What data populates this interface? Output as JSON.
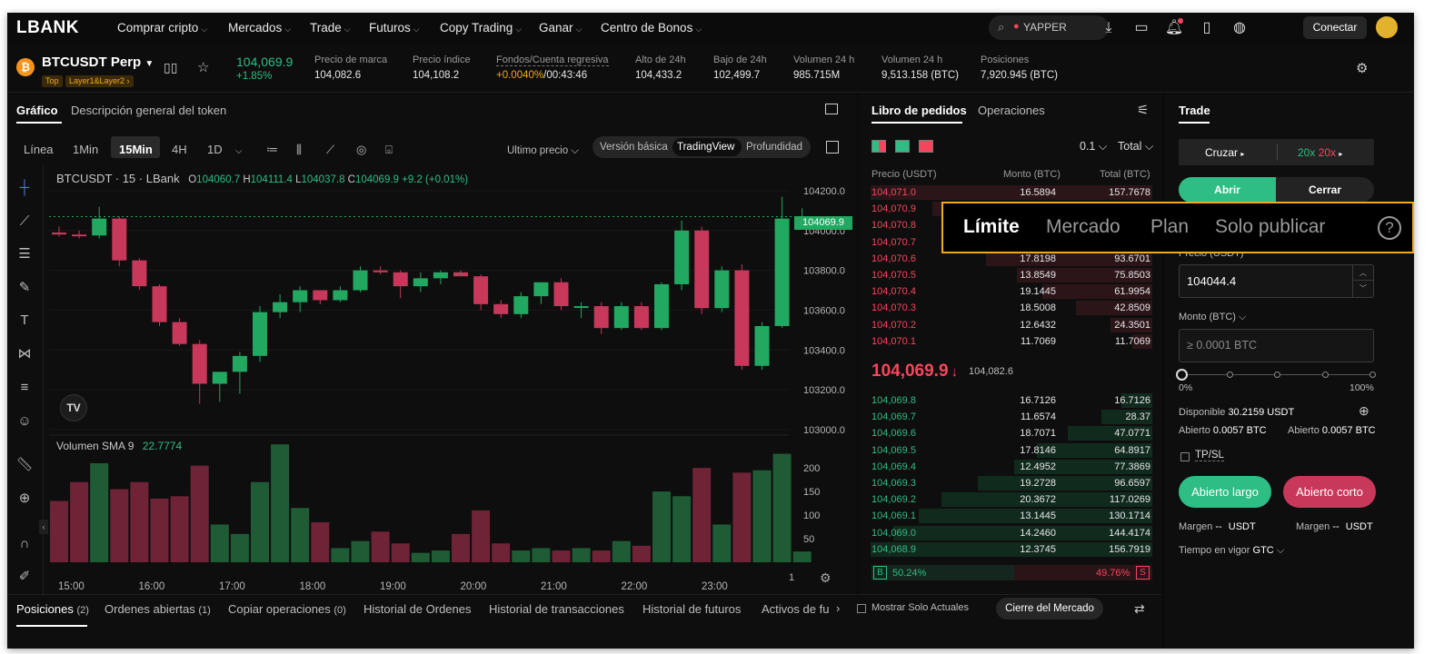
{
  "nav": {
    "logo": "LBANK",
    "items": [
      "Comprar cripto",
      "Mercados",
      "Trade",
      "Futuros",
      "Copy Trading",
      "Ganar",
      "Centro de Bonos"
    ],
    "search_placeholder": "YAPPER",
    "connect": "Conectar"
  },
  "ticker": {
    "pair": "BTCUSDT Perp",
    "tag_top": "Top",
    "tag_layer": "Layer1&Layer2",
    "price": "104,069.9",
    "change": "+1.85%",
    "stats": [
      {
        "label": "Precio de marca",
        "value": "104,082.6"
      },
      {
        "label": "Precio índice",
        "value": "104,108.2"
      },
      {
        "label": "Fondos/Cuenta regresiva",
        "value_rate": "+0.0040%",
        "value_timer": "/00:43:46"
      },
      {
        "label": "Alto de 24h",
        "value": "104,433.2"
      },
      {
        "label": "Bajo de 24h",
        "value": "102,499.7"
      },
      {
        "label": "Volumen 24 h",
        "value": "985.715M"
      },
      {
        "label": "Volumen 24 h",
        "value": "9,513.158 (BTC)"
      },
      {
        "label": "Posiciones",
        "value": "7,920.945 (BTC)"
      }
    ]
  },
  "chart_panel": {
    "tabs": [
      "Gráfico",
      "Descripción general del token"
    ],
    "timeframes": [
      "Línea",
      "1Min",
      "15Min",
      "4H",
      "1D"
    ],
    "active_timeframe": "15Min",
    "price_mode": "Ultimo precio",
    "views": [
      "Versión básica",
      "TradingView",
      "Profundidad"
    ],
    "active_view": "TradingView",
    "symbol_line": "BTCUSDT · 15 · LBank",
    "ohlc": {
      "o": "104060.7",
      "h": "104111.4",
      "l": "104037.8",
      "c": "104069.9",
      "chg": "+9.2 (+0.01%)"
    },
    "last_price_label": "104069.9",
    "volume_label": "Volumen SMA 9",
    "volume_value": "22.7774",
    "scale_mode": "1"
  },
  "chart_data": {
    "type": "candlestick",
    "x_ticks": [
      "15:00",
      "16:00",
      "17:00",
      "18:00",
      "19:00",
      "20:00",
      "21:00",
      "22:00",
      "23:00"
    ],
    "y_ticks": [
      104200.0,
      104000.0,
      103800.0,
      103600.0,
      103400.0,
      103200.0,
      103000.0
    ],
    "ylim": [
      102995,
      104250
    ],
    "volume_ticks": [
      200,
      150,
      100,
      50
    ],
    "volume_ylim": [
      0,
      260
    ],
    "candles": [
      {
        "o": 103990,
        "h": 104020,
        "l": 103970,
        "c": 103980,
        "v": 130
      },
      {
        "o": 103980,
        "h": 104000,
        "l": 103960,
        "c": 103975,
        "v": 170
      },
      {
        "o": 103975,
        "h": 104120,
        "l": 103960,
        "c": 104060,
        "v": 210
      },
      {
        "o": 104060,
        "h": 104070,
        "l": 103820,
        "c": 103850,
        "v": 155
      },
      {
        "o": 103850,
        "h": 103860,
        "l": 103700,
        "c": 103720,
        "v": 170
      },
      {
        "o": 103720,
        "h": 103730,
        "l": 103520,
        "c": 103540,
        "v": 135
      },
      {
        "o": 103540,
        "h": 103560,
        "l": 103420,
        "c": 103430,
        "v": 140
      },
      {
        "o": 103430,
        "h": 103450,
        "l": 103130,
        "c": 103230,
        "v": 205
      },
      {
        "o": 103230,
        "h": 103290,
        "l": 103140,
        "c": 103290,
        "v": 80
      },
      {
        "o": 103290,
        "h": 103390,
        "l": 103180,
        "c": 103370,
        "v": 60
      },
      {
        "o": 103370,
        "h": 103620,
        "l": 103340,
        "c": 103590,
        "v": 170
      },
      {
        "o": 103590,
        "h": 103680,
        "l": 103560,
        "c": 103640,
        "v": 250
      },
      {
        "o": 103640,
        "h": 103720,
        "l": 103590,
        "c": 103700,
        "v": 115
      },
      {
        "o": 103700,
        "h": 103700,
        "l": 103630,
        "c": 103650,
        "v": 85
      },
      {
        "o": 103650,
        "h": 103720,
        "l": 103640,
        "c": 103700,
        "v": 30
      },
      {
        "o": 103700,
        "h": 103820,
        "l": 103690,
        "c": 103800,
        "v": 45
      },
      {
        "o": 103800,
        "h": 103820,
        "l": 103780,
        "c": 103790,
        "v": 65
      },
      {
        "o": 103790,
        "h": 103800,
        "l": 103660,
        "c": 103720,
        "v": 40
      },
      {
        "o": 103720,
        "h": 103790,
        "l": 103690,
        "c": 103760,
        "v": 20
      },
      {
        "o": 103760,
        "h": 103800,
        "l": 103730,
        "c": 103790,
        "v": 25
      },
      {
        "o": 103790,
        "h": 103800,
        "l": 103770,
        "c": 103770,
        "v": 60
      },
      {
        "o": 103770,
        "h": 103780,
        "l": 103600,
        "c": 103630,
        "v": 110
      },
      {
        "o": 103630,
        "h": 103650,
        "l": 103560,
        "c": 103580,
        "v": 40
      },
      {
        "o": 103580,
        "h": 103690,
        "l": 103560,
        "c": 103670,
        "v": 25
      },
      {
        "o": 103670,
        "h": 103740,
        "l": 103630,
        "c": 103740,
        "v": 30
      },
      {
        "o": 103740,
        "h": 103760,
        "l": 103600,
        "c": 103620,
        "v": 25
      },
      {
        "o": 103620,
        "h": 103640,
        "l": 103560,
        "c": 103620,
        "v": 30
      },
      {
        "o": 103620,
        "h": 103640,
        "l": 103480,
        "c": 103510,
        "v": 25
      },
      {
        "o": 103510,
        "h": 103640,
        "l": 103500,
        "c": 103620,
        "v": 45
      },
      {
        "o": 103620,
        "h": 103640,
        "l": 103500,
        "c": 103510,
        "v": 35
      },
      {
        "o": 103510,
        "h": 103740,
        "l": 103500,
        "c": 103730,
        "v": 150
      },
      {
        "o": 103730,
        "h": 104050,
        "l": 103700,
        "c": 104000,
        "v": 140
      },
      {
        "o": 104000,
        "h": 104020,
        "l": 103580,
        "c": 103610,
        "v": 200
      },
      {
        "o": 103610,
        "h": 103820,
        "l": 103590,
        "c": 103800,
        "v": 80
      },
      {
        "o": 103800,
        "h": 103830,
        "l": 103300,
        "c": 103320,
        "v": 190
      },
      {
        "o": 103320,
        "h": 103540,
        "l": 103300,
        "c": 103520,
        "v": 195
      },
      {
        "o": 103520,
        "h": 104170,
        "l": 103510,
        "c": 104060,
        "v": 230
      },
      {
        "o": 104060,
        "h": 104111.4,
        "l": 104037.8,
        "c": 104069.9,
        "v": 22.7774
      }
    ]
  },
  "orderbook": {
    "tabs": [
      "Libro de pedidos",
      "Operaciones"
    ],
    "precision": "0.1",
    "total_mode": "Total",
    "headers": [
      "Precio (USDT)",
      "Monto (BTC)",
      "Total (BTC)"
    ],
    "asks": [
      {
        "price": "104,071.0",
        "amount": "16.5894",
        "total": "157.7678"
      },
      {
        "price": "104,070.9",
        "amount": "",
        "total": ""
      },
      {
        "price": "104,070.8",
        "amount": "",
        "total": ""
      },
      {
        "price": "104,070.7",
        "amount": "",
        "total": ""
      },
      {
        "price": "104,070.6",
        "amount": "17.8198",
        "total": "93.6701"
      },
      {
        "price": "104,070.5",
        "amount": "13.8549",
        "total": "75.8503"
      },
      {
        "price": "104,070.4",
        "amount": "19.1445",
        "total": "61.9954"
      },
      {
        "price": "104,070.3",
        "amount": "18.5008",
        "total": "42.8509"
      },
      {
        "price": "104,070.2",
        "amount": "12.6432",
        "total": "24.3501"
      },
      {
        "price": "104,070.1",
        "amount": "11.7069",
        "total": "11.7069"
      }
    ],
    "ask_depth": [
      1.0,
      0.78,
      0.74,
      0.68,
      0.59,
      0.48,
      0.39,
      0.27,
      0.15,
      0.07
    ],
    "mid_price": "104,069.9",
    "mid_arrow": "↓",
    "mark_price": "104,082.6",
    "bids": [
      {
        "price": "104,069.8",
        "amount": "16.7126",
        "total": "16.7126"
      },
      {
        "price": "104,069.7",
        "amount": "11.6574",
        "total": "28.37"
      },
      {
        "price": "104,069.6",
        "amount": "18.7071",
        "total": "47.0771"
      },
      {
        "price": "104,069.5",
        "amount": "17.8146",
        "total": "64.8917"
      },
      {
        "price": "104,069.4",
        "amount": "12.4952",
        "total": "77.3869"
      },
      {
        "price": "104,069.3",
        "amount": "19.2728",
        "total": "96.6597"
      },
      {
        "price": "104,069.2",
        "amount": "20.3672",
        "total": "117.0269"
      },
      {
        "price": "104,069.1",
        "amount": "13.1445",
        "total": "130.1714"
      },
      {
        "price": "104,069.0",
        "amount": "14.2460",
        "total": "144.4174"
      },
      {
        "price": "104,068.9",
        "amount": "12.3745",
        "total": "156.7919"
      }
    ],
    "bid_depth": [
      0.11,
      0.18,
      0.3,
      0.41,
      0.49,
      0.62,
      0.75,
      0.83,
      0.92,
      1.0
    ],
    "buy_label": "B",
    "buy_pct": "50.24%",
    "sell_pct": "49.76%",
    "sell_label": "S"
  },
  "trade": {
    "title": "Trade",
    "margin_mode": "Cruzar",
    "lev_long": "20x",
    "lev_short": "20x",
    "open": "Abrir",
    "close": "Cerrar",
    "price_label": "Precio (USDT)",
    "price_value": "104044.4",
    "amount_label": "Monto (BTC)",
    "amount_placeholder": "≥ 0.0001 BTC",
    "slider_min": "0%",
    "slider_max": "100%",
    "slider_value": 0,
    "available_label": "Disponible",
    "available_value": "30.2159 USDT",
    "open_label": "Abierto",
    "open_long_value": "0.0057 BTC",
    "open_short_value": "0.0057 BTC",
    "tpsl": "TP/SL",
    "long_btn": "Abierto largo",
    "short_btn": "Abierto corto",
    "margin_label": "Margen",
    "margin_value": "--",
    "margin_unit": "USDT",
    "tif_label": "Tiempo en vigor",
    "tif_value": "GTC"
  },
  "order_type_popup": {
    "tabs": [
      "Límite",
      "Mercado",
      "Plan",
      "Solo publicar"
    ],
    "active": "Límite",
    "help": "?"
  },
  "bottom": {
    "tabs": [
      {
        "label": "Posiciones",
        "count": "(2)"
      },
      {
        "label": "Ordenes abiertas",
        "count": "(1)"
      },
      {
        "label": "Copiar operaciones",
        "count": "(0)"
      },
      {
        "label": "Historial de Ordenes",
        "count": ""
      },
      {
        "label": "Historial de transacciones",
        "count": ""
      },
      {
        "label": "Historial de futuros",
        "count": ""
      },
      {
        "label": "Activos de fu",
        "count": ""
      }
    ],
    "show_current": "Mostrar Solo Actuales",
    "close_market": "Cierre del Mercado"
  },
  "colors": {
    "up": "#2ebd85",
    "down": "#f6465d",
    "up_candle": "#22a861",
    "down_candle": "#c8385a",
    "accent": "#f2a91e"
  }
}
